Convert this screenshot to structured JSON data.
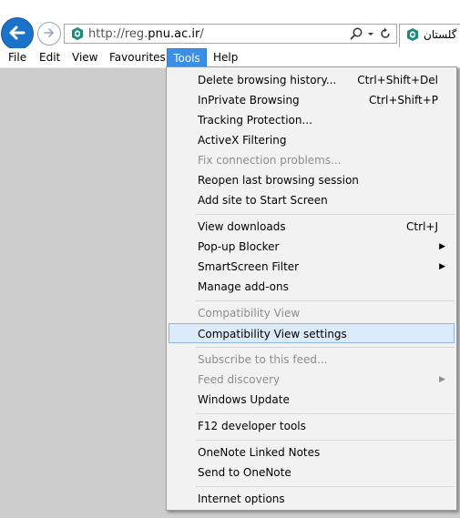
{
  "address_bar": {
    "url": "http://reg.pnu.ac.ir/",
    "url_prefix": "http://reg.",
    "url_host": "pnu.ac.ir",
    "url_suffix": "/"
  },
  "tab": {
    "title": "گلستان"
  },
  "menubar": [
    "File",
    "Edit",
    "View",
    "Favourites",
    "Tools",
    "Help"
  ],
  "menubar_active": "Tools",
  "tools_menu": {
    "group1": [
      {
        "label": "Delete browsing history...",
        "shortcut": "Ctrl+Shift+Del",
        "enabled": true
      },
      {
        "label": "InPrivate Browsing",
        "shortcut": "Ctrl+Shift+P",
        "enabled": true
      },
      {
        "label": "Tracking Protection...",
        "shortcut": "",
        "enabled": true
      },
      {
        "label": "ActiveX Filtering",
        "shortcut": "",
        "enabled": true
      },
      {
        "label": "Fix connection problems...",
        "shortcut": "",
        "enabled": false
      },
      {
        "label": "Reopen last browsing session",
        "shortcut": "",
        "enabled": true
      },
      {
        "label": "Add site to Start Screen",
        "shortcut": "",
        "enabled": true
      }
    ],
    "group2": [
      {
        "label": "View downloads",
        "shortcut": "Ctrl+J",
        "enabled": true
      },
      {
        "label": "Pop-up Blocker",
        "submenu": true,
        "enabled": true
      },
      {
        "label": "SmartScreen Filter",
        "submenu": true,
        "enabled": true
      },
      {
        "label": "Manage add-ons",
        "enabled": true
      }
    ],
    "group3": [
      {
        "label": "Compatibility View",
        "enabled": false
      },
      {
        "label": "Compatibility View settings",
        "enabled": true,
        "highlighted": true
      }
    ],
    "group4": [
      {
        "label": "Subscribe to this feed...",
        "enabled": false
      },
      {
        "label": "Feed discovery",
        "submenu": true,
        "enabled": false
      },
      {
        "label": "Windows Update",
        "enabled": true
      }
    ],
    "group5": [
      {
        "label": "F12 developer tools",
        "enabled": true
      }
    ],
    "group6": [
      {
        "label": "OneNote Linked Notes",
        "enabled": true
      },
      {
        "label": "Send to OneNote",
        "enabled": true
      }
    ],
    "group7": [
      {
        "label": "Internet options",
        "enabled": true
      }
    ]
  },
  "icons": {
    "back": "back-arrow-icon",
    "forward": "forward-arrow-icon",
    "site": "site-favicon-icon",
    "search": "search-icon",
    "dropdown": "chevron-down-icon",
    "refresh": "refresh-icon",
    "submenu": "submenu-arrow-icon"
  },
  "colors": {
    "accent": "#3a8ee6",
    "back_button": "#1a73c9",
    "highlight": "#dcebf9",
    "disabled_text": "#8d8d8d",
    "page_background": "#cdcdcd"
  }
}
